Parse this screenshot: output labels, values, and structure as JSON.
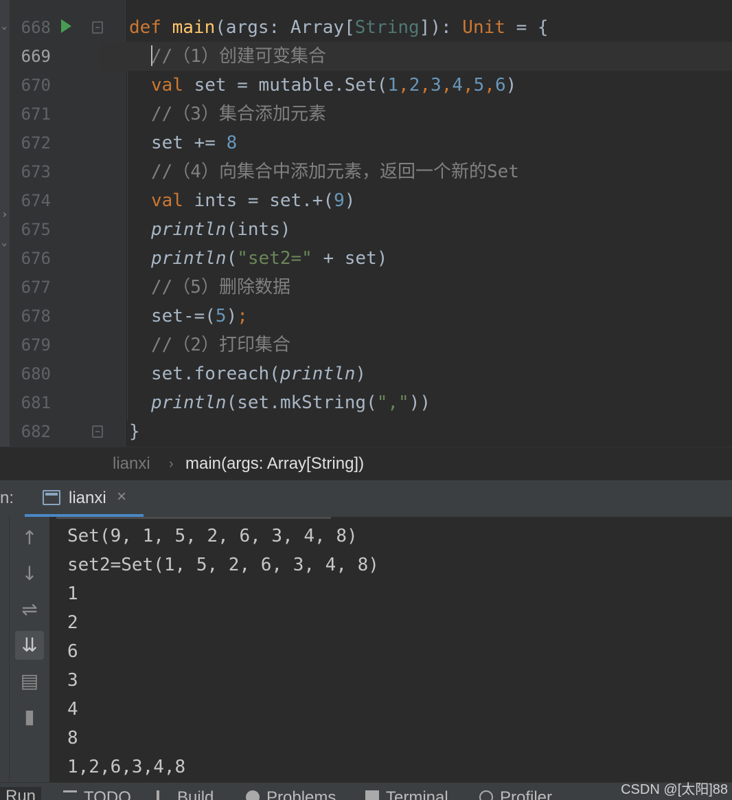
{
  "editor": {
    "lines": [
      {
        "num": "668",
        "tokens": [
          [
            "kw",
            "def "
          ],
          [
            "fn",
            "main"
          ],
          [
            "",
            "(args: Array["
          ],
          [
            "typeparam",
            "String"
          ],
          [
            "",
            "]): "
          ],
          [
            "kw",
            "Unit"
          ],
          [
            "",
            " = {"
          ]
        ]
      },
      {
        "num": "669",
        "tokens": [
          [
            "cm",
            "//（1）创建可变集合"
          ]
        ]
      },
      {
        "num": "670",
        "tokens": [
          [
            "kw",
            "val "
          ],
          [
            "",
            "set = mutable.Set("
          ],
          [
            "num",
            "1"
          ],
          [
            "kw",
            ","
          ],
          [
            "num",
            "2"
          ],
          [
            "kw",
            ","
          ],
          [
            "num",
            "3"
          ],
          [
            "kw",
            ","
          ],
          [
            "num",
            "4"
          ],
          [
            "kw",
            ","
          ],
          [
            "num",
            "5"
          ],
          [
            "kw",
            ","
          ],
          [
            "num",
            "6"
          ],
          [
            "",
            ")"
          ]
        ]
      },
      {
        "num": "671",
        "tokens": [
          [
            "cm",
            "//（3）集合添加元素"
          ]
        ]
      },
      {
        "num": "672",
        "tokens": [
          [
            "",
            "set += "
          ],
          [
            "num",
            "8"
          ]
        ]
      },
      {
        "num": "673",
        "tokens": [
          [
            "cm",
            "//（4）向集合中添加元素，返回一个新的Set"
          ]
        ]
      },
      {
        "num": "674",
        "tokens": [
          [
            "kw",
            "val "
          ],
          [
            "",
            "ints = set.+("
          ],
          [
            "num",
            "9"
          ],
          [
            "",
            ")"
          ]
        ]
      },
      {
        "num": "675",
        "tokens": [
          [
            "it",
            "println"
          ],
          [
            "",
            "(ints)"
          ]
        ]
      },
      {
        "num": "676",
        "tokens": [
          [
            "it",
            "println"
          ],
          [
            "",
            "("
          ],
          [
            "str",
            "\"set2=\""
          ],
          [
            "",
            " + set)"
          ]
        ]
      },
      {
        "num": "677",
        "tokens": [
          [
            "cm",
            "//（5）删除数据"
          ]
        ]
      },
      {
        "num": "678",
        "tokens": [
          [
            "",
            "set-=("
          ],
          [
            "num",
            "5"
          ],
          [
            "",
            ")"
          ],
          [
            "kw",
            ";"
          ]
        ]
      },
      {
        "num": "679",
        "tokens": [
          [
            "cm",
            "//（2）打印集合"
          ]
        ]
      },
      {
        "num": "680",
        "tokens": [
          [
            "",
            "set.foreach("
          ],
          [
            "it",
            "println"
          ],
          [
            "",
            ")"
          ]
        ]
      },
      {
        "num": "681",
        "tokens": [
          [
            "it",
            "println"
          ],
          [
            "",
            "(set.mkString("
          ],
          [
            "str",
            "\",\""
          ],
          [
            "",
            "))"
          ]
        ]
      },
      {
        "num": "682",
        "tokens": [
          [
            "",
            "}"
          ]
        ]
      }
    ]
  },
  "breadcrumb": {
    "object": "lianxi",
    "method": "main(args: Array[String])"
  },
  "run": {
    "prefix": "n:",
    "tab_label": "lianxi",
    "close": "×"
  },
  "toolbar_icons": [
    "arrow-up-icon",
    "arrow-down-icon",
    "soft-wrap-icon",
    "scroll-to-end-icon",
    "print-icon",
    "trash-icon"
  ],
  "console": {
    "output": [
      "Set(9, 1, 5, 2, 6, 3, 4, 8)",
      "set2=Set(1, 5, 2, 6, 3, 4, 8)",
      "1",
      "2",
      "6",
      "3",
      "4",
      "8",
      "1,2,6,3,4,8"
    ]
  },
  "bottom_tabs": {
    "run": "Run",
    "todo": "TODO",
    "build": "Build",
    "problems": "Problems",
    "terminal": "Terminal",
    "profiler": "Profiler"
  },
  "watermark": "CSDN @[太阳]88",
  "colors": {
    "keyword": "#cc7832",
    "function": "#ffc66d",
    "number": "#6897bb",
    "string": "#6a8759",
    "comment": "#808080",
    "run_green": "#499c54",
    "accent_blue": "#4a88c7"
  }
}
